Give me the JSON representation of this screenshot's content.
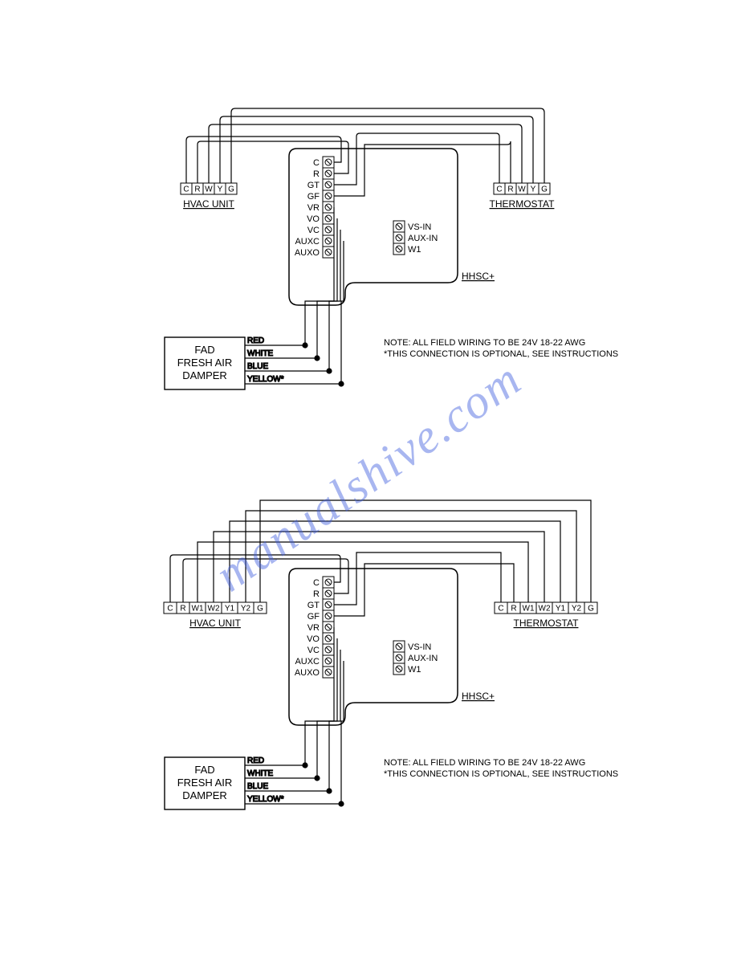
{
  "watermark": "manualshive.com",
  "diagrams": [
    {
      "hvac": {
        "label": "HVAC UNIT",
        "terminals": [
          "C",
          "R",
          "W",
          "Y",
          "G"
        ]
      },
      "thermostat": {
        "label": "THERMOSTAT",
        "terminals": [
          "C",
          "R",
          "W",
          "Y",
          "G"
        ]
      },
      "controller": {
        "label": "HHSC+",
        "left_terminals": [
          "C",
          "R",
          "GT",
          "GF",
          "VR",
          "VO",
          "VC",
          "AUXC",
          "AUXO"
        ],
        "right_terminals": [
          "VS-IN",
          "AUX-IN",
          "W1"
        ]
      },
      "fad": {
        "line1": "FAD",
        "line2": "FRESH AIR",
        "line3": "DAMPER",
        "wires": [
          "RED",
          "WHITE",
          "BLUE",
          "YELLOW*"
        ]
      },
      "note1": "NOTE: ALL FIELD WIRING TO BE 24V 18-22 AWG",
      "note2": "*THIS CONNECTION IS OPTIONAL, SEE INSTRUCTIONS"
    },
    {
      "hvac": {
        "label": "HVAC UNIT",
        "terminals": [
          "C",
          "R",
          "W1",
          "W2",
          "Y1",
          "Y2",
          "G"
        ]
      },
      "thermostat": {
        "label": "THERMOSTAT",
        "terminals": [
          "C",
          "R",
          "W1",
          "W2",
          "Y1",
          "Y2",
          "G"
        ]
      },
      "controller": {
        "label": "HHSC+",
        "left_terminals": [
          "C",
          "R",
          "GT",
          "GF",
          "VR",
          "VO",
          "VC",
          "AUXC",
          "AUXO"
        ],
        "right_terminals": [
          "VS-IN",
          "AUX-IN",
          "W1"
        ]
      },
      "fad": {
        "line1": "FAD",
        "line2": "FRESH AIR",
        "line3": "DAMPER",
        "wires": [
          "RED",
          "WHITE",
          "BLUE",
          "YELLOW*"
        ]
      },
      "note1": "NOTE: ALL FIELD WIRING TO BE 24V 18-22 AWG",
      "note2": "*THIS CONNECTION IS OPTIONAL, SEE INSTRUCTIONS"
    }
  ]
}
